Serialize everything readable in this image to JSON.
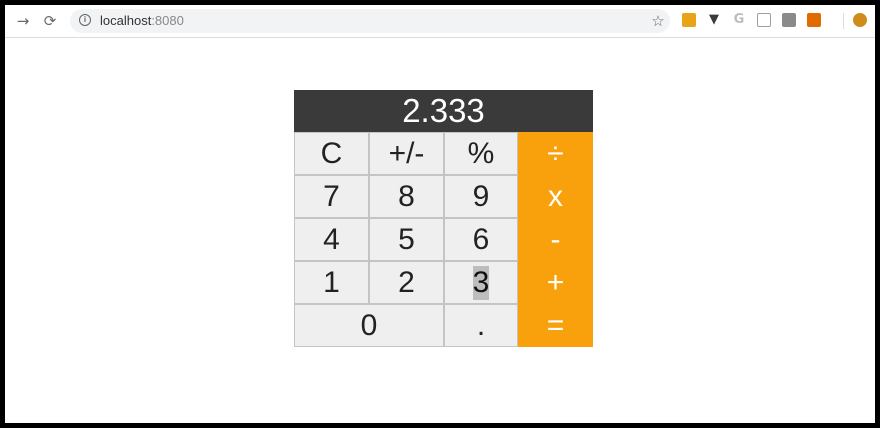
{
  "browser": {
    "url_host": "localhost",
    "url_port": ":8080",
    "icons": {
      "back": "arrow-right-icon",
      "reload": "reload-icon",
      "site_info": "info-icon",
      "bookmark": "star-icon"
    },
    "extensions": [
      {
        "name": "extension-orange-icon",
        "color": "#e8a317"
      },
      {
        "name": "extension-v-icon",
        "color": "#3b3b3b"
      },
      {
        "name": "extension-g-icon",
        "color": "#bdbdbd"
      },
      {
        "name": "extension-doc-icon",
        "color": "#9e9e9e"
      },
      {
        "name": "extension-windows-icon",
        "color": "#8a8a8a"
      },
      {
        "name": "extension-box-icon",
        "color": "#e06c00"
      },
      {
        "name": "extension-fox-icon",
        "color": "#d08a1e"
      }
    ]
  },
  "calculator": {
    "display_value": "2.333",
    "display_bg": "#3a3a3a",
    "accent_color": "#f9a00d",
    "key_bg": "#efefef",
    "selected_key": "3",
    "keys": {
      "clear": "C",
      "sign": "+/-",
      "percent": "%",
      "divide": "÷",
      "seven": "7",
      "eight": "8",
      "nine": "9",
      "multiply": "x",
      "four": "4",
      "five": "5",
      "six": "6",
      "subtract": "-",
      "one": "1",
      "two": "2",
      "three": "3",
      "add": "+",
      "zero": "0",
      "decimal": ".",
      "equals": "="
    }
  }
}
